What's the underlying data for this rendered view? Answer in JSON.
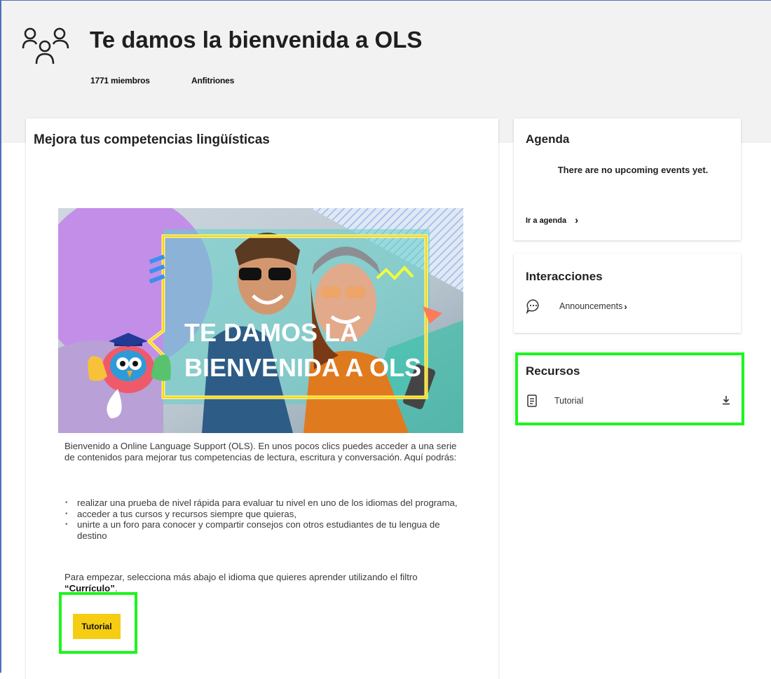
{
  "colors": {
    "accent_yellow": "#f5cd13",
    "highlight_green": "#1ef51e",
    "header_bg": "#f2f2f2",
    "frame_blue": "#4a72b8"
  },
  "header": {
    "icon": "group-people-icon",
    "title": "Te damos la bienvenida a OLS",
    "members": "1771 miembros",
    "hosts": "Anfitriones"
  },
  "main": {
    "heading": "Mejora tus competencias lingüísticas",
    "banner": {
      "line1": "TE DAMOS LA",
      "line2": "BIENVENIDA A OLS"
    },
    "intro": "Bienvenido a Online Language Support (OLS). En unos pocos clics puedes acceder a una serie de contenidos para mejorar tus competencias de lectura, escritura y conversación. Aquí podrás:",
    "bullets": [
      "realizar una prueba de nivel rápida para evaluar tu nivel en uno de los idiomas del programa,",
      "acceder a tus cursos y recursos siempre que quieras,",
      "unirte a un foro para conocer y compartir consejos con otros estudiantes de tu lengua de destino"
    ],
    "closing_text": "Para empezar, selecciona más abajo el idioma que quieres aprender utilizando el filtro ",
    "closing_bold": "“Currículo”",
    "closing_end": ".",
    "button": "Tutorial"
  },
  "agenda": {
    "title": "Agenda",
    "empty": "There are no upcoming events yet.",
    "link": "Ir a agenda",
    "link_icon": "chevron-right-icon"
  },
  "interacciones": {
    "title": "Interacciones",
    "item": "Announcements",
    "item_icon": "chat-bubble-icon",
    "chevron": "chevron-right-icon"
  },
  "recursos": {
    "title": "Recursos",
    "item": "Tutorial",
    "item_icon": "document-icon",
    "download_icon": "download-icon"
  }
}
